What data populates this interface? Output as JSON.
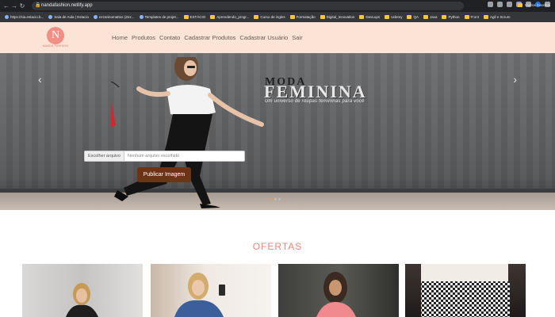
{
  "browser": {
    "url": "nandafashion.netlify.app",
    "bookmarks": [
      {
        "label": "https://sia.estacio.b...",
        "icon": "favicon"
      },
      {
        "label": "Sala de Aula | Estacio",
        "icon": "favicon"
      },
      {
        "label": "ezzarinomattos (Zez...",
        "icon": "github-icon"
      },
      {
        "label": "Templates de projet...",
        "icon": "favicon"
      },
      {
        "label": "ESTÁCIO",
        "icon": "folder"
      },
      {
        "label": "Aprendendo_progr...",
        "icon": "folder"
      },
      {
        "label": "Curso de ingles",
        "icon": "folder"
      },
      {
        "label": "Formatação",
        "icon": "folder"
      },
      {
        "label": "Digital_Innovation",
        "icon": "folder"
      },
      {
        "label": "DevLups",
        "icon": "folder"
      },
      {
        "label": "Udemy",
        "icon": "folder"
      },
      {
        "label": "QA",
        "icon": "folder"
      },
      {
        "label": "Java",
        "icon": "folder"
      },
      {
        "label": "Python",
        "icon": "folder"
      },
      {
        "label": "Front",
        "icon": "folder"
      },
      {
        "label": "Agil e Scrum",
        "icon": "folder"
      }
    ],
    "other_bookmarks": "Outros favoritos"
  },
  "header": {
    "logo_letter": "N",
    "logo_sub": "NANDA FASHION",
    "menu": [
      "Home",
      "Produtos",
      "Contato",
      "Cadastrar Produtos",
      "Cadastrar Usuário",
      "Sair"
    ]
  },
  "hero": {
    "title_line1": "MODA",
    "title_line2": "FEMININA",
    "subtitle": "Um universo de roupas femininas para você",
    "file_button": "Escolher arquivo",
    "file_placeholder": "Nenhum arquivo escolhido",
    "publish_button": "Publicar Imagem",
    "prev_icon": "‹",
    "next_icon": "›",
    "slide_count": 3,
    "active_slide": 1
  },
  "offers": {
    "title": "OFERTAS",
    "cards": 4
  }
}
